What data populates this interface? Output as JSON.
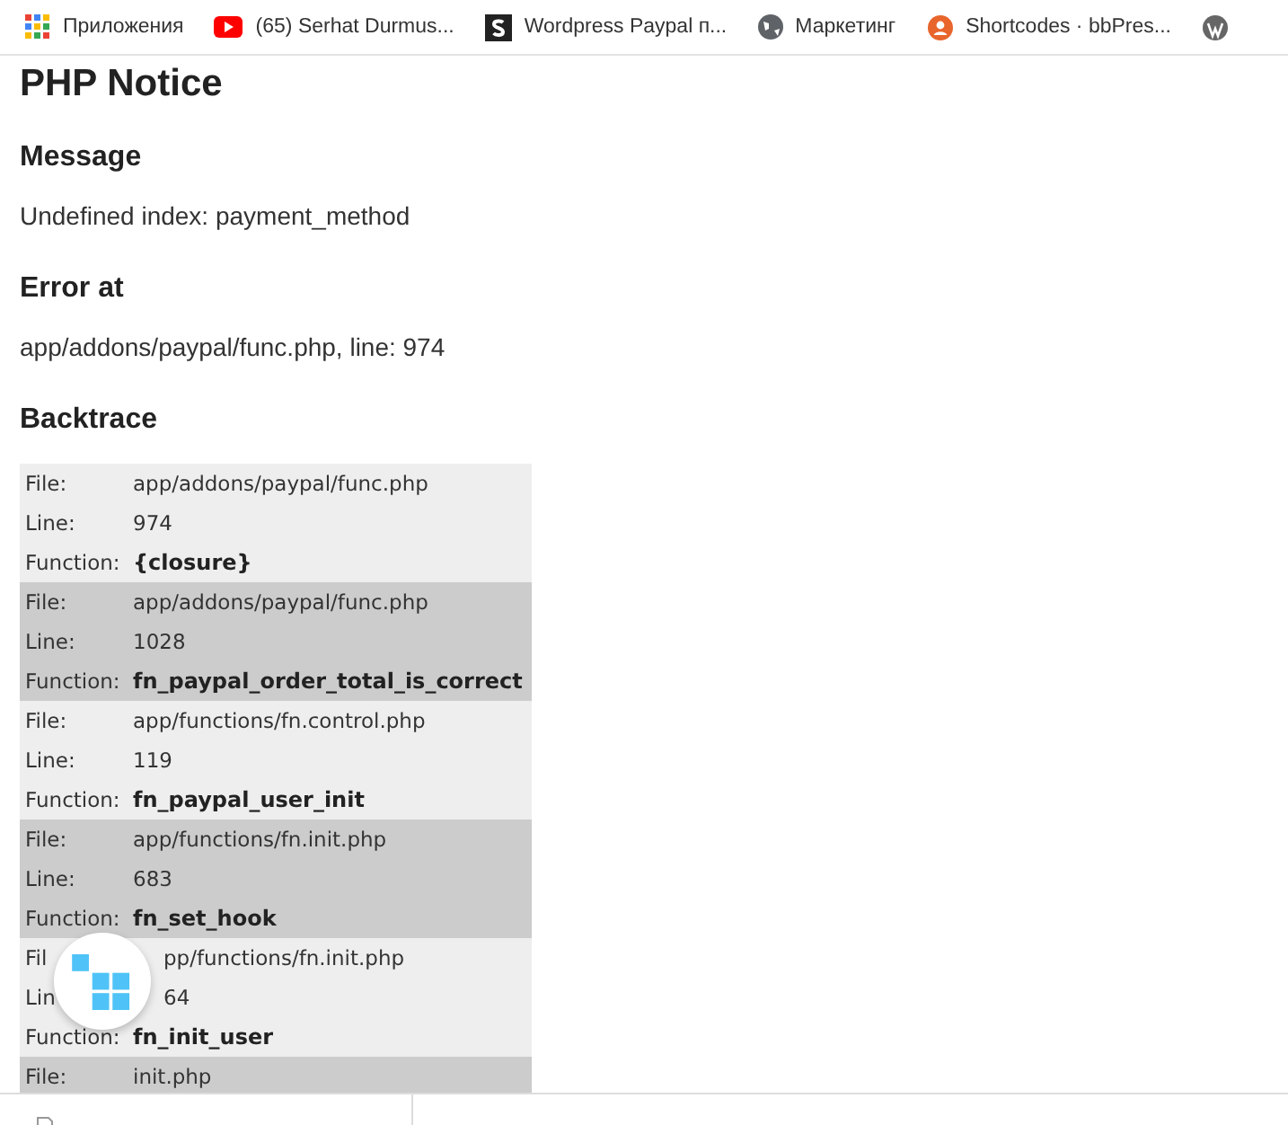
{
  "bookmarks": [
    {
      "kind": "apps",
      "label": "Приложения"
    },
    {
      "kind": "video",
      "label": "(65) Serhat Durmus..."
    },
    {
      "kind": "letter",
      "label": "Wordpress Paypal п..."
    },
    {
      "kind": "globe",
      "label": "Маркетинг"
    },
    {
      "kind": "badge",
      "label": "Shortcodes · bbPres..."
    },
    {
      "kind": "wp"
    }
  ],
  "title": "PHP Notice",
  "sections": [
    {
      "heading": "Message",
      "text": "Undefined index: payment_method"
    },
    {
      "heading": "Error at",
      "text": "app/addons/paypal/func.php, line: 974"
    }
  ],
  "backtrace": {
    "heading": "Backtrace",
    "frames": [
      {
        "rows": [
          {
            "kind": "plain",
            "label": "File:",
            "value": "app/addons/paypal/func.php"
          },
          {
            "kind": "plain",
            "label": "Line:",
            "value": "974"
          },
          {
            "kind": "function",
            "label": "Function:",
            "value": "{closure}"
          }
        ]
      },
      {
        "rows": [
          {
            "kind": "plain",
            "label": "File:",
            "value": "app/addons/paypal/func.php"
          },
          {
            "kind": "plain",
            "label": "Line:",
            "value": "1028"
          },
          {
            "kind": "function",
            "label": "Function:",
            "value": "fn_paypal_order_total_is_correct"
          }
        ]
      },
      {
        "rows": [
          {
            "kind": "plain",
            "label": "File:",
            "value": "app/functions/fn.control.php"
          },
          {
            "kind": "plain",
            "label": "Line:",
            "value": "119"
          },
          {
            "kind": "function",
            "label": "Function:",
            "value": "fn_paypal_user_init"
          }
        ]
      },
      {
        "rows": [
          {
            "kind": "plain",
            "label": "File:",
            "value": "app/functions/fn.init.php"
          },
          {
            "kind": "plain",
            "label": "Line:",
            "value": "683"
          },
          {
            "kind": "function",
            "label": "Function:",
            "value": "fn_set_hook"
          }
        ]
      },
      {
        "rows": [
          {
            "kind": "covered",
            "label": "Fil",
            "value": "pp/functions/fn.init.php"
          },
          {
            "kind": "covered",
            "label": "Lin",
            "value": "64"
          },
          {
            "kind": "function",
            "label": "Function:",
            "value": "fn_init_user"
          }
        ]
      },
      {
        "rows": [
          {
            "kind": "plain",
            "label": "File:",
            "value": "init.php"
          }
        ]
      }
    ]
  }
}
